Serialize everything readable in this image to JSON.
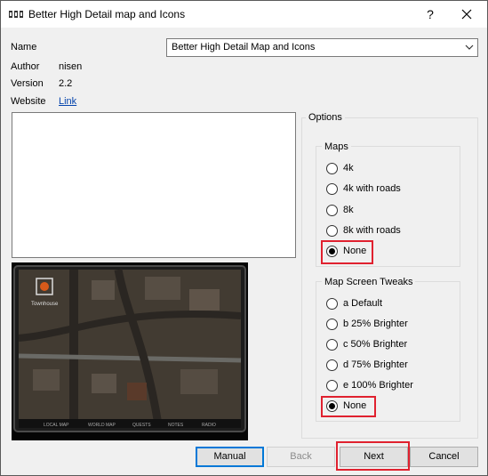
{
  "window": {
    "title": "Better High Detail map and Icons",
    "help_glyph": "?",
    "close_glyph": "✕"
  },
  "fields": {
    "name_label": "Name",
    "name_value": "Better High Detail Map and Icons",
    "author_label": "Author",
    "author_value": "nisen",
    "version_label": "Version",
    "version_value": "2.2",
    "website_label": "Website",
    "website_link": "Link"
  },
  "description": "",
  "preview": {
    "location_label": "Townhouse",
    "tabs": [
      "LOCAL MAP",
      "WORLD MAP",
      "QUESTS",
      "NOTES",
      "RADIO"
    ]
  },
  "options": {
    "title": "Options",
    "groups": [
      {
        "title": "Maps",
        "items": [
          {
            "label": "4k",
            "checked": false
          },
          {
            "label": "4k with roads",
            "checked": false
          },
          {
            "label": "8k",
            "checked": false
          },
          {
            "label": "8k with roads",
            "checked": false
          },
          {
            "label": "None",
            "checked": true
          }
        ]
      },
      {
        "title": "Map Screen Tweaks",
        "items": [
          {
            "label": "a Default",
            "checked": false
          },
          {
            "label": "b 25% Brighter",
            "checked": false
          },
          {
            "label": "c 50% Brighter",
            "checked": false
          },
          {
            "label": "d 75% Brighter",
            "checked": false
          },
          {
            "label": "e 100% Brighter",
            "checked": false
          },
          {
            "label": "None",
            "checked": true
          }
        ]
      }
    ]
  },
  "buttons": {
    "manual": "Manual",
    "back": "Back",
    "next": "Next",
    "cancel": "Cancel"
  },
  "colors": {
    "highlight": "#e0212f",
    "focus": "#0078d7",
    "link": "#0645ad"
  }
}
